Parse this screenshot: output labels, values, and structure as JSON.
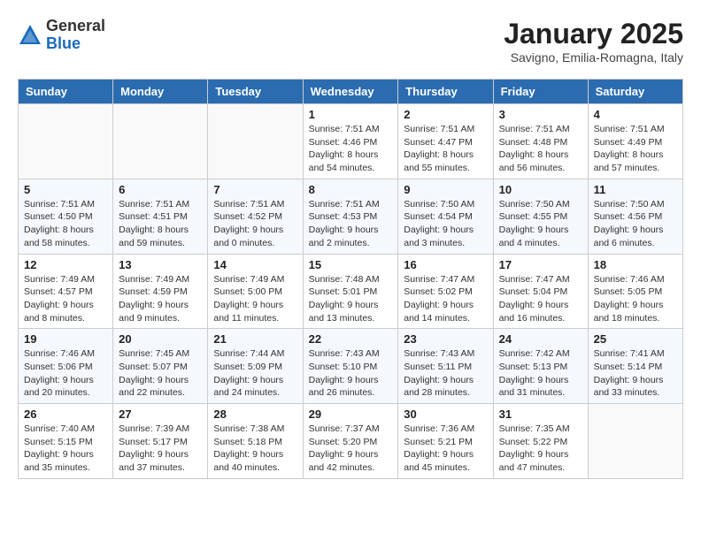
{
  "logo": {
    "general": "General",
    "blue": "Blue"
  },
  "title": "January 2025",
  "subtitle": "Savigno, Emilia-Romagna, Italy",
  "days_of_week": [
    "Sunday",
    "Monday",
    "Tuesday",
    "Wednesday",
    "Thursday",
    "Friday",
    "Saturday"
  ],
  "weeks": [
    [
      {
        "day": "",
        "info": ""
      },
      {
        "day": "",
        "info": ""
      },
      {
        "day": "",
        "info": ""
      },
      {
        "day": "1",
        "info": "Sunrise: 7:51 AM\nSunset: 4:46 PM\nDaylight: 8 hours\nand 54 minutes."
      },
      {
        "day": "2",
        "info": "Sunrise: 7:51 AM\nSunset: 4:47 PM\nDaylight: 8 hours\nand 55 minutes."
      },
      {
        "day": "3",
        "info": "Sunrise: 7:51 AM\nSunset: 4:48 PM\nDaylight: 8 hours\nand 56 minutes."
      },
      {
        "day": "4",
        "info": "Sunrise: 7:51 AM\nSunset: 4:49 PM\nDaylight: 8 hours\nand 57 minutes."
      }
    ],
    [
      {
        "day": "5",
        "info": "Sunrise: 7:51 AM\nSunset: 4:50 PM\nDaylight: 8 hours\nand 58 minutes."
      },
      {
        "day": "6",
        "info": "Sunrise: 7:51 AM\nSunset: 4:51 PM\nDaylight: 8 hours\nand 59 minutes."
      },
      {
        "day": "7",
        "info": "Sunrise: 7:51 AM\nSunset: 4:52 PM\nDaylight: 9 hours\nand 0 minutes."
      },
      {
        "day": "8",
        "info": "Sunrise: 7:51 AM\nSunset: 4:53 PM\nDaylight: 9 hours\nand 2 minutes."
      },
      {
        "day": "9",
        "info": "Sunrise: 7:50 AM\nSunset: 4:54 PM\nDaylight: 9 hours\nand 3 minutes."
      },
      {
        "day": "10",
        "info": "Sunrise: 7:50 AM\nSunset: 4:55 PM\nDaylight: 9 hours\nand 4 minutes."
      },
      {
        "day": "11",
        "info": "Sunrise: 7:50 AM\nSunset: 4:56 PM\nDaylight: 9 hours\nand 6 minutes."
      }
    ],
    [
      {
        "day": "12",
        "info": "Sunrise: 7:49 AM\nSunset: 4:57 PM\nDaylight: 9 hours\nand 8 minutes."
      },
      {
        "day": "13",
        "info": "Sunrise: 7:49 AM\nSunset: 4:59 PM\nDaylight: 9 hours\nand 9 minutes."
      },
      {
        "day": "14",
        "info": "Sunrise: 7:49 AM\nSunset: 5:00 PM\nDaylight: 9 hours\nand 11 minutes."
      },
      {
        "day": "15",
        "info": "Sunrise: 7:48 AM\nSunset: 5:01 PM\nDaylight: 9 hours\nand 13 minutes."
      },
      {
        "day": "16",
        "info": "Sunrise: 7:47 AM\nSunset: 5:02 PM\nDaylight: 9 hours\nand 14 minutes."
      },
      {
        "day": "17",
        "info": "Sunrise: 7:47 AM\nSunset: 5:04 PM\nDaylight: 9 hours\nand 16 minutes."
      },
      {
        "day": "18",
        "info": "Sunrise: 7:46 AM\nSunset: 5:05 PM\nDaylight: 9 hours\nand 18 minutes."
      }
    ],
    [
      {
        "day": "19",
        "info": "Sunrise: 7:46 AM\nSunset: 5:06 PM\nDaylight: 9 hours\nand 20 minutes."
      },
      {
        "day": "20",
        "info": "Sunrise: 7:45 AM\nSunset: 5:07 PM\nDaylight: 9 hours\nand 22 minutes."
      },
      {
        "day": "21",
        "info": "Sunrise: 7:44 AM\nSunset: 5:09 PM\nDaylight: 9 hours\nand 24 minutes."
      },
      {
        "day": "22",
        "info": "Sunrise: 7:43 AM\nSunset: 5:10 PM\nDaylight: 9 hours\nand 26 minutes."
      },
      {
        "day": "23",
        "info": "Sunrise: 7:43 AM\nSunset: 5:11 PM\nDaylight: 9 hours\nand 28 minutes."
      },
      {
        "day": "24",
        "info": "Sunrise: 7:42 AM\nSunset: 5:13 PM\nDaylight: 9 hours\nand 31 minutes."
      },
      {
        "day": "25",
        "info": "Sunrise: 7:41 AM\nSunset: 5:14 PM\nDaylight: 9 hours\nand 33 minutes."
      }
    ],
    [
      {
        "day": "26",
        "info": "Sunrise: 7:40 AM\nSunset: 5:15 PM\nDaylight: 9 hours\nand 35 minutes."
      },
      {
        "day": "27",
        "info": "Sunrise: 7:39 AM\nSunset: 5:17 PM\nDaylight: 9 hours\nand 37 minutes."
      },
      {
        "day": "28",
        "info": "Sunrise: 7:38 AM\nSunset: 5:18 PM\nDaylight: 9 hours\nand 40 minutes."
      },
      {
        "day": "29",
        "info": "Sunrise: 7:37 AM\nSunset: 5:20 PM\nDaylight: 9 hours\nand 42 minutes."
      },
      {
        "day": "30",
        "info": "Sunrise: 7:36 AM\nSunset: 5:21 PM\nDaylight: 9 hours\nand 45 minutes."
      },
      {
        "day": "31",
        "info": "Sunrise: 7:35 AM\nSunset: 5:22 PM\nDaylight: 9 hours\nand 47 minutes."
      },
      {
        "day": "",
        "info": ""
      }
    ]
  ]
}
